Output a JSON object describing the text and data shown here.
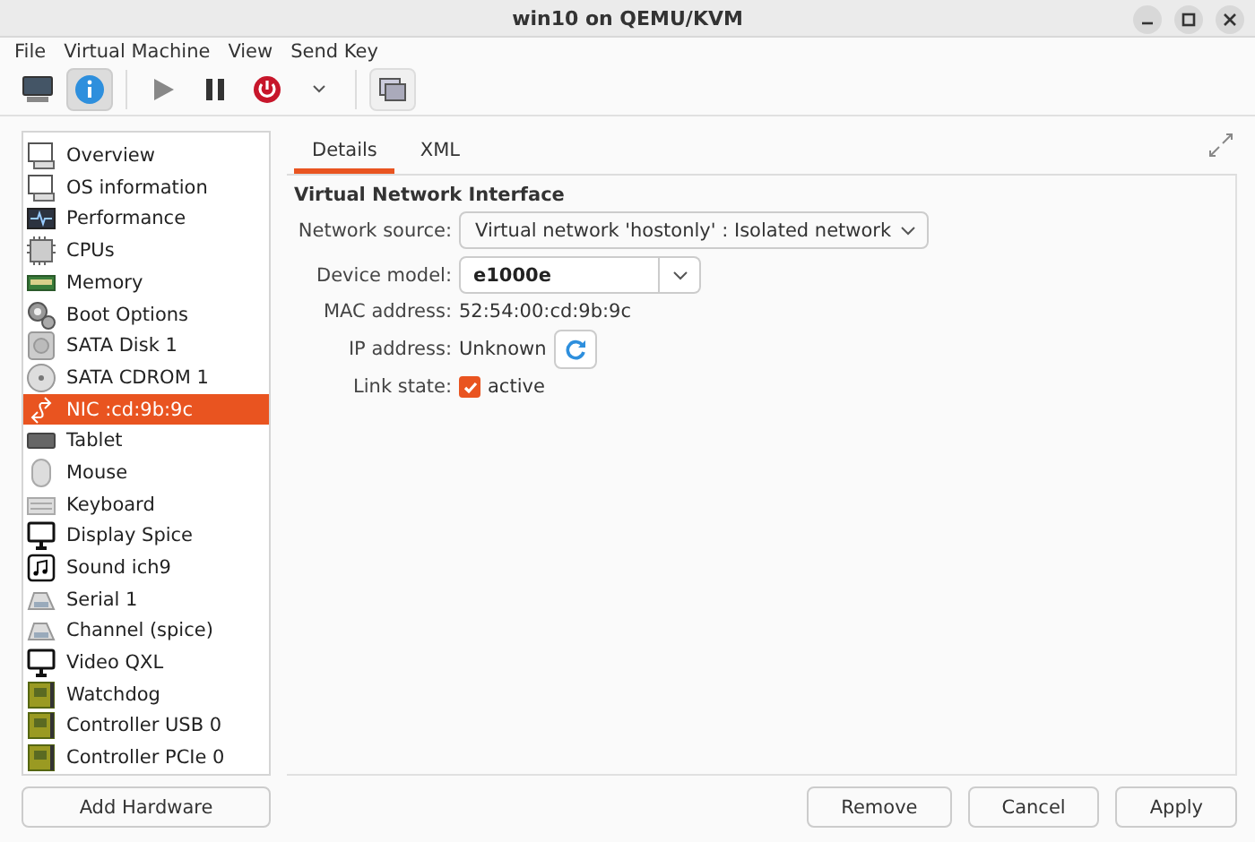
{
  "window": {
    "title": "win10 on QEMU/KVM"
  },
  "menu": [
    "File",
    "Virtual Machine",
    "View",
    "Send Key"
  ],
  "toolbar": {
    "details_selected": true
  },
  "sidebar": {
    "items": [
      {
        "label": "Overview",
        "selected": false
      },
      {
        "label": "OS information",
        "selected": false
      },
      {
        "label": "Performance",
        "selected": false
      },
      {
        "label": "CPUs",
        "selected": false
      },
      {
        "label": "Memory",
        "selected": false
      },
      {
        "label": "Boot Options",
        "selected": false
      },
      {
        "label": "SATA Disk 1",
        "selected": false
      },
      {
        "label": "SATA CDROM 1",
        "selected": false
      },
      {
        "label": "NIC :cd:9b:9c",
        "selected": true
      },
      {
        "label": "Tablet",
        "selected": false
      },
      {
        "label": "Mouse",
        "selected": false
      },
      {
        "label": "Keyboard",
        "selected": false
      },
      {
        "label": "Display Spice",
        "selected": false
      },
      {
        "label": "Sound ich9",
        "selected": false
      },
      {
        "label": "Serial 1",
        "selected": false
      },
      {
        "label": "Channel (spice)",
        "selected": false
      },
      {
        "label": "Video QXL",
        "selected": false
      },
      {
        "label": "Watchdog",
        "selected": false
      },
      {
        "label": "Controller USB 0",
        "selected": false
      },
      {
        "label": "Controller PCIe 0",
        "selected": false
      }
    ],
    "add_button": "Add Hardware"
  },
  "tabs": [
    {
      "label": "Details",
      "selected": true
    },
    {
      "label": "XML",
      "selected": false
    }
  ],
  "section_title": "Virtual Network Interface",
  "fields": [
    {
      "kind": "dropdown",
      "label": "Network source:",
      "value": "Virtual network 'hostonly' : Isolated network"
    },
    {
      "kind": "combo",
      "label": "Device model:",
      "value": "e1000e"
    },
    {
      "kind": "text",
      "label": "MAC address:",
      "value": "52:54:00:cd:9b:9c"
    },
    {
      "kind": "refresh",
      "label": "IP address:",
      "value": "Unknown"
    },
    {
      "kind": "check",
      "label": "Link state:",
      "value": "active",
      "checked": true
    }
  ],
  "buttons": [
    "Remove",
    "Cancel",
    "Apply"
  ]
}
